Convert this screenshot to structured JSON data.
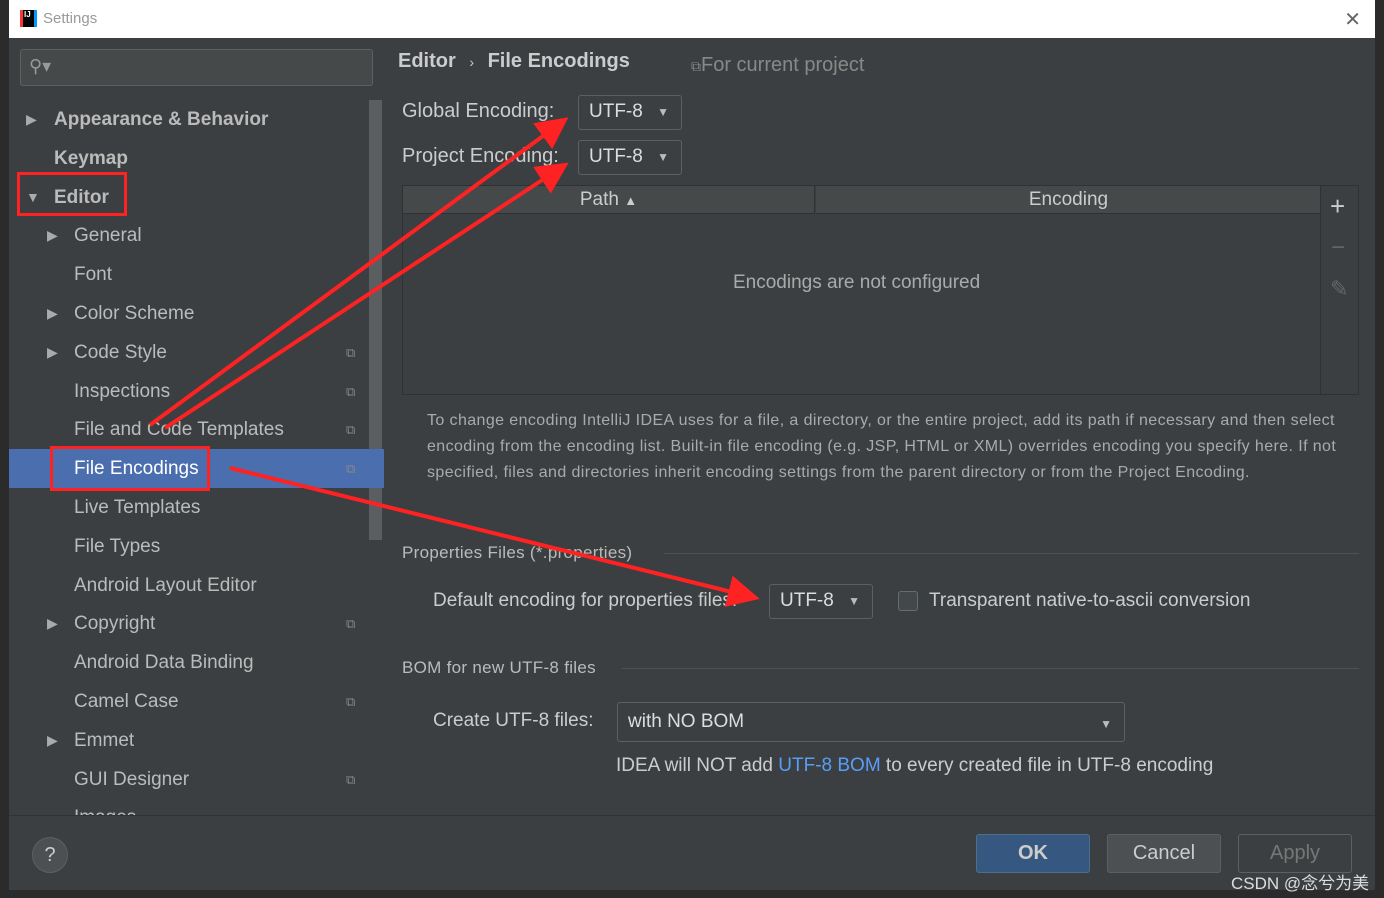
{
  "window": {
    "title": "Settings",
    "close_icon": "close-icon"
  },
  "sidebar": {
    "search_placeholder": "",
    "items": [
      {
        "label": "Appearance & Behavior",
        "expandable": true,
        "bold": true
      },
      {
        "label": "Keymap",
        "bold": true
      },
      {
        "label": "Editor",
        "expandable": true,
        "expanded": true,
        "bold": true
      },
      {
        "label": "General",
        "expandable": true
      },
      {
        "label": "Font"
      },
      {
        "label": "Color Scheme",
        "expandable": true
      },
      {
        "label": "Code Style",
        "expandable": true,
        "project_icon": true
      },
      {
        "label": "Inspections",
        "project_icon": true
      },
      {
        "label": "File and Code Templates",
        "project_icon": true
      },
      {
        "label": "File Encodings",
        "project_icon": true,
        "selected": true
      },
      {
        "label": "Live Templates"
      },
      {
        "label": "File Types"
      },
      {
        "label": "Android Layout Editor"
      },
      {
        "label": "Copyright",
        "expandable": true,
        "project_icon": true
      },
      {
        "label": "Android Data Binding"
      },
      {
        "label": "Camel Case",
        "project_icon": true
      },
      {
        "label": "Emmet",
        "expandable": true
      },
      {
        "label": "GUI Designer",
        "project_icon": true
      },
      {
        "label": "Images"
      }
    ]
  },
  "main": {
    "breadcrumb": {
      "parent": "Editor",
      "sep": "›",
      "current": "File Encodings"
    },
    "scope": "For current project",
    "global_label": "Global Encoding:",
    "global_value": "UTF-8",
    "project_label": "Project Encoding:",
    "project_value": "UTF-8",
    "table": {
      "columns": [
        "Path",
        "Encoding"
      ],
      "sort": "Path ascending",
      "empty": "Encodings are not configured",
      "add": "+",
      "remove": "−",
      "edit": "✎"
    },
    "description": "To change encoding IntelliJ IDEA uses for a file, a directory, or the entire project, add its path if necessary and then select encoding from the encoding list. Built-in file encoding (e.g. JSP, HTML or XML) overrides encoding you specify here. If not specified, files and directories inherit encoding settings from the parent directory or from the Project Encoding.",
    "properties": {
      "title": "Properties Files (*.properties)",
      "default_label": "Default encoding for properties files:",
      "default_value": "UTF-8",
      "transparent_label": "Transparent native-to-ascii conversion",
      "transparent_checked": false
    },
    "bom": {
      "title": "BOM for new UTF-8 files",
      "create_label": "Create UTF-8 files:",
      "create_value": "with NO BOM",
      "note_pre": "IDEA will NOT add ",
      "note_link": "UTF-8 BOM",
      "note_post": " to every created file in UTF-8 encoding"
    }
  },
  "footer": {
    "help": "?",
    "ok": "OK",
    "cancel": "Cancel",
    "apply": "Apply"
  },
  "watermark": "CSDN @念兮为美",
  "colors": {
    "selection": "#4b6eaf",
    "annotation": "#ff2222",
    "link": "#589df6"
  }
}
